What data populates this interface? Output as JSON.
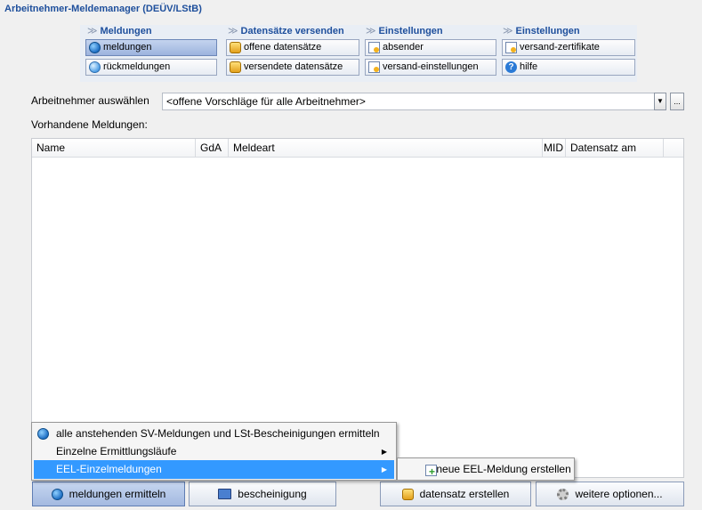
{
  "window_title": "Arbeitnehmer-Meldemanager (DEÜV/LStB)",
  "ribbon": {
    "groups": [
      {
        "title": "Meldungen",
        "buttons": [
          {
            "label": "meldungen",
            "icon": "globe-icon"
          },
          {
            "label": "rückmeldungen",
            "icon": "globe-icon"
          }
        ]
      },
      {
        "title": "Datensätze versenden",
        "buttons": [
          {
            "label": "offene datensätze",
            "icon": "database-icon"
          },
          {
            "label": "versendete datensätze",
            "icon": "database-icon"
          }
        ]
      },
      {
        "title": "Einstellungen",
        "buttons": [
          {
            "label": "absender",
            "icon": "certificate-icon"
          },
          {
            "label": "versand-einstellungen",
            "icon": "certificate-icon"
          }
        ]
      },
      {
        "title": "Einstellungen",
        "buttons": [
          {
            "label": "versand-zertifikate",
            "icon": "certificate-icon"
          },
          {
            "label": "hilfe",
            "icon": "help-icon"
          }
        ]
      }
    ]
  },
  "employee_select": {
    "label": "Arbeitnehmer auswählen",
    "value": "<offene Vorschläge für alle Arbeitnehmer>",
    "button_label": "..."
  },
  "list": {
    "label": "Vorhandene Meldungen:",
    "columns": [
      "Name",
      "GdA",
      "Meldeart",
      "MID",
      "Datensatz am"
    ],
    "rows": []
  },
  "context_menu": {
    "items": [
      {
        "label": "alle anstehenden SV-Meldungen und LSt-Bescheinigungen ermitteln"
      },
      {
        "label": "Einzelne Ermittlungsläufe"
      },
      {
        "label": "EEL-Einzelmeldungen"
      }
    ],
    "submenu": {
      "items": [
        {
          "label": "neue EEL-Meldung erstellen"
        }
      ]
    }
  },
  "bottom_buttons": {
    "meldungen_ermitteln": "meldungen ermitteln",
    "bescheinigung": "bescheinigung",
    "datensatz_erstellen": "datensatz erstellen",
    "weitere_optionen": "weitere optionen..."
  },
  "colors": {
    "title": "#1e4f9c",
    "ribbon_bg": "#e9eef5",
    "selected_button": "#a3b9e0",
    "menu_highlight": "#3399ff"
  }
}
